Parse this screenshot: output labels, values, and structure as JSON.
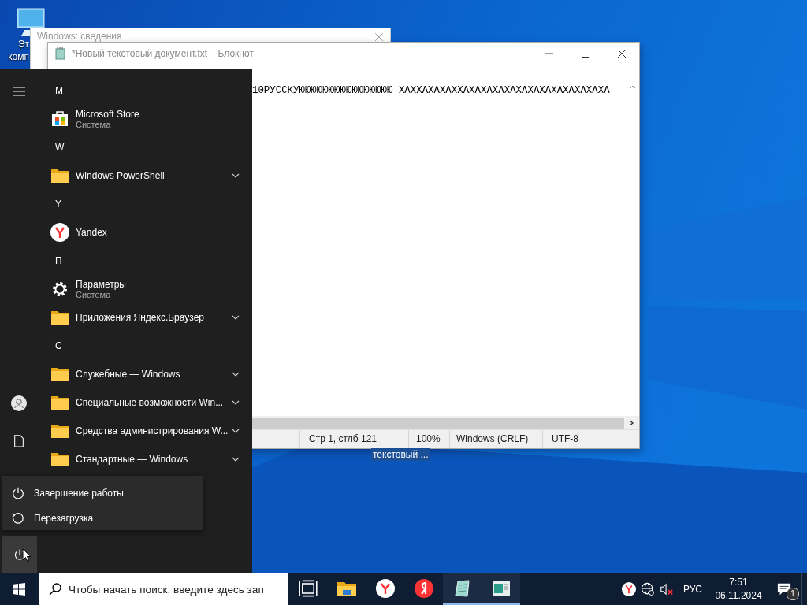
{
  "desktop_icon": {
    "label_lines": [
      "Эт",
      "комп"
    ]
  },
  "desktop_file": {
    "label": "текстовый ...",
    "selected": true
  },
  "back_window": {
    "title": "Windows: сведения"
  },
  "notepad": {
    "title": "*Новый текстовый документ.txt – Блокнот",
    "text": "10РУССКУЮЮЮЮЮЮЮЮЮЮЮЮЮЮЮЮ ХАХХАХАХАХХАХАХАХАХАХАХАХАХАХАХАХАХА",
    "status_bar": [
      "Стр 1, стлб 121",
      "100%",
      "Windows (CRLF)",
      "UTF-8"
    ]
  },
  "start_menu": {
    "groups": [
      {
        "letter": "M",
        "items": [
          {
            "kind": "store",
            "name": "Microsoft Store",
            "subtitle": "Система",
            "expandable": false
          }
        ]
      },
      {
        "letter": "W",
        "items": [
          {
            "kind": "folder",
            "name": "Windows PowerShell",
            "expandable": true
          }
        ]
      },
      {
        "letter": "Y",
        "items": [
          {
            "kind": "yandex",
            "name": "Yandex",
            "expandable": false
          }
        ]
      },
      {
        "letter": "П",
        "items": [
          {
            "kind": "settings",
            "name": "Параметры",
            "subtitle": "Система",
            "expandable": false
          },
          {
            "kind": "folder",
            "name": "Приложения Яндекс.Браузер",
            "expandable": true
          }
        ]
      },
      {
        "letter": "С",
        "items": [
          {
            "kind": "folder",
            "name": "Служебные — Windows",
            "expandable": true
          },
          {
            "kind": "folder",
            "name": "Специальные возможности Win...",
            "expandable": true
          },
          {
            "kind": "folder",
            "name": "Средства администрирования W...",
            "expandable": true
          },
          {
            "kind": "folder",
            "name": "Стандартные — Windows",
            "expandable": true
          }
        ]
      }
    ],
    "power_menu": [
      {
        "kind": "shutdown",
        "label": "Завершение работы"
      },
      {
        "kind": "restart",
        "label": "Перезагрузка"
      }
    ]
  },
  "taskbar": {
    "search": {
      "placeholder": "Чтобы начать поиск, введите здесь зап"
    },
    "apps": [
      {
        "kind": "taskview",
        "running": false
      },
      {
        "kind": "explorer",
        "running": false
      },
      {
        "kind": "yandex_browser",
        "running": false
      },
      {
        "kind": "yandex",
        "running": false
      },
      {
        "kind": "notepad",
        "running": true
      },
      {
        "kind": "sysinfo",
        "running": true
      }
    ],
    "tray": {
      "language": "РУС",
      "time": "7:51",
      "date": "06.11.2024",
      "notifications": "1"
    }
  }
}
